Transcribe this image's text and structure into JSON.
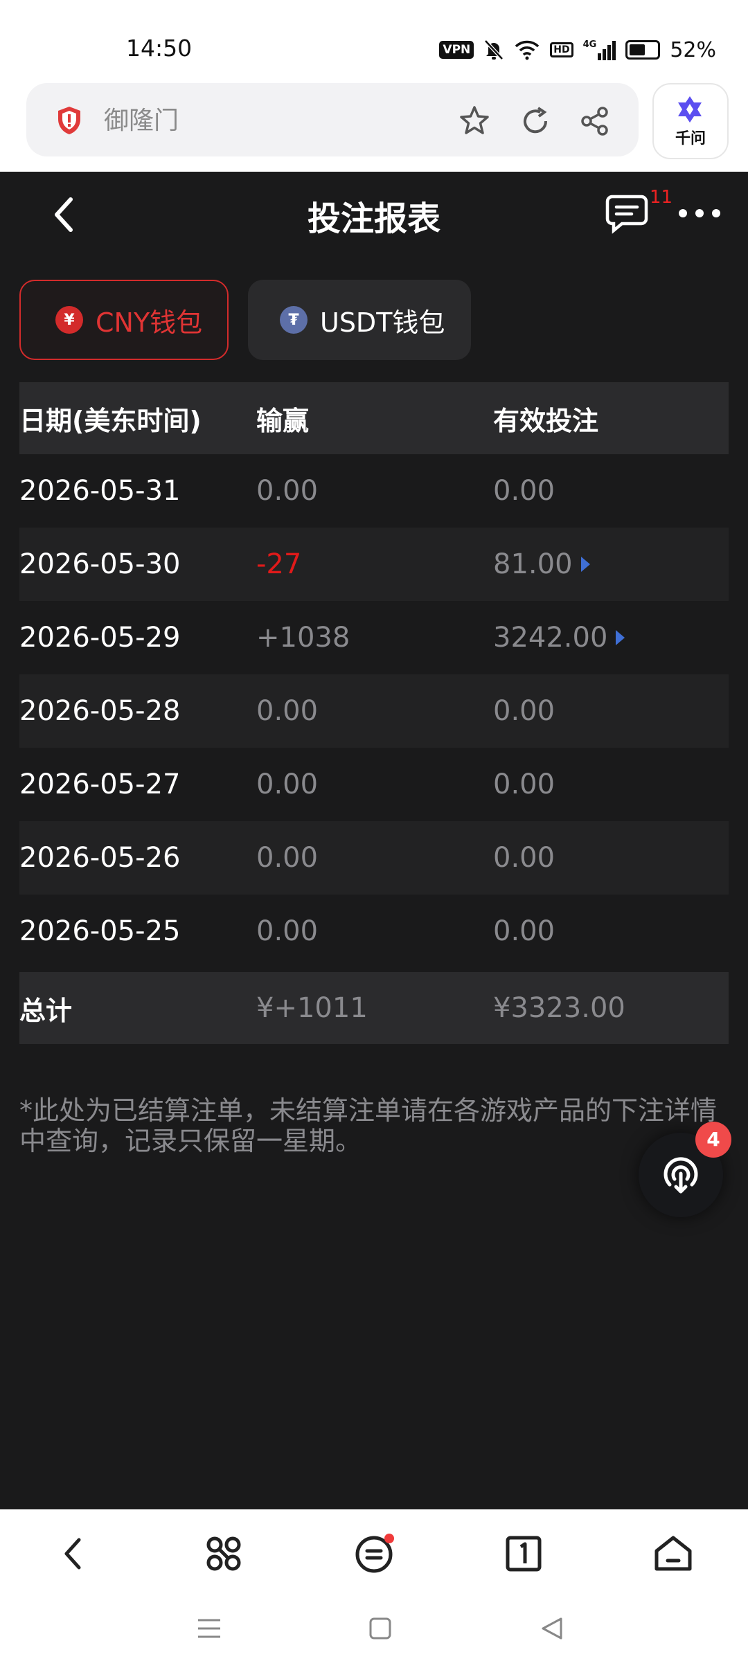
{
  "status_bar": {
    "time": "14:50",
    "vpn": "VPN",
    "hd": "HD",
    "network": "4G",
    "battery": "52%"
  },
  "browser": {
    "url_text": "御隆门",
    "assistant_label": "千问"
  },
  "header": {
    "title": "投注报表",
    "message_count": "11"
  },
  "wallet_tabs": [
    {
      "label": "CNY钱包",
      "symbol": "¥",
      "active": true
    },
    {
      "label": "USDT钱包",
      "symbol": "₮",
      "active": false
    }
  ],
  "table": {
    "columns": [
      "日期(美东时间)",
      "输赢",
      "有效投注"
    ],
    "rows": [
      {
        "date": "2026-05-31",
        "win_loss": "0.00",
        "valid_bet": "0.00"
      },
      {
        "date": "2026-05-30",
        "win_loss": "-27",
        "valid_bet": "81.00"
      },
      {
        "date": "2026-05-29",
        "win_loss": "+1038",
        "valid_bet": "3242.00"
      },
      {
        "date": "2026-05-28",
        "win_loss": "0.00",
        "valid_bet": "0.00"
      },
      {
        "date": "2026-05-27",
        "win_loss": "0.00",
        "valid_bet": "0.00"
      },
      {
        "date": "2026-05-26",
        "win_loss": "0.00",
        "valid_bet": "0.00"
      },
      {
        "date": "2026-05-25",
        "win_loss": "0.00",
        "valid_bet": "0.00"
      }
    ],
    "total": {
      "label": "总计",
      "win_loss": "¥+1011",
      "valid_bet": "¥3323.00"
    }
  },
  "note": "*此处为已结算注单，未结算注单请在各游戏产品的下注详情中查询，记录只保留一星期。",
  "float_button": {
    "badge": "4"
  },
  "colors": {
    "background": "#1a1a1b",
    "negative": "#e11a1a",
    "accent_red": "#d32b2b",
    "badge": "#f04a4a"
  }
}
